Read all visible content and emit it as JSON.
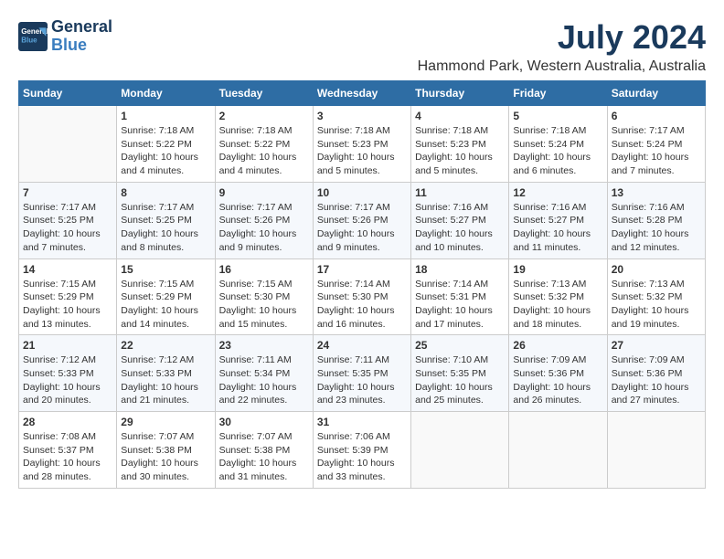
{
  "logo": {
    "line1": "General",
    "line2": "Blue"
  },
  "title": "July 2024",
  "subtitle": "Hammond Park, Western Australia, Australia",
  "columns": [
    "Sunday",
    "Monday",
    "Tuesday",
    "Wednesday",
    "Thursday",
    "Friday",
    "Saturday"
  ],
  "weeks": [
    [
      {
        "day": "",
        "info": ""
      },
      {
        "day": "1",
        "info": "Sunrise: 7:18 AM\nSunset: 5:22 PM\nDaylight: 10 hours\nand 4 minutes."
      },
      {
        "day": "2",
        "info": "Sunrise: 7:18 AM\nSunset: 5:22 PM\nDaylight: 10 hours\nand 4 minutes."
      },
      {
        "day": "3",
        "info": "Sunrise: 7:18 AM\nSunset: 5:23 PM\nDaylight: 10 hours\nand 5 minutes."
      },
      {
        "day": "4",
        "info": "Sunrise: 7:18 AM\nSunset: 5:23 PM\nDaylight: 10 hours\nand 5 minutes."
      },
      {
        "day": "5",
        "info": "Sunrise: 7:18 AM\nSunset: 5:24 PM\nDaylight: 10 hours\nand 6 minutes."
      },
      {
        "day": "6",
        "info": "Sunrise: 7:17 AM\nSunset: 5:24 PM\nDaylight: 10 hours\nand 7 minutes."
      }
    ],
    [
      {
        "day": "7",
        "info": "Sunrise: 7:17 AM\nSunset: 5:25 PM\nDaylight: 10 hours\nand 7 minutes."
      },
      {
        "day": "8",
        "info": "Sunrise: 7:17 AM\nSunset: 5:25 PM\nDaylight: 10 hours\nand 8 minutes."
      },
      {
        "day": "9",
        "info": "Sunrise: 7:17 AM\nSunset: 5:26 PM\nDaylight: 10 hours\nand 9 minutes."
      },
      {
        "day": "10",
        "info": "Sunrise: 7:17 AM\nSunset: 5:26 PM\nDaylight: 10 hours\nand 9 minutes."
      },
      {
        "day": "11",
        "info": "Sunrise: 7:16 AM\nSunset: 5:27 PM\nDaylight: 10 hours\nand 10 minutes."
      },
      {
        "day": "12",
        "info": "Sunrise: 7:16 AM\nSunset: 5:27 PM\nDaylight: 10 hours\nand 11 minutes."
      },
      {
        "day": "13",
        "info": "Sunrise: 7:16 AM\nSunset: 5:28 PM\nDaylight: 10 hours\nand 12 minutes."
      }
    ],
    [
      {
        "day": "14",
        "info": "Sunrise: 7:15 AM\nSunset: 5:29 PM\nDaylight: 10 hours\nand 13 minutes."
      },
      {
        "day": "15",
        "info": "Sunrise: 7:15 AM\nSunset: 5:29 PM\nDaylight: 10 hours\nand 14 minutes."
      },
      {
        "day": "16",
        "info": "Sunrise: 7:15 AM\nSunset: 5:30 PM\nDaylight: 10 hours\nand 15 minutes."
      },
      {
        "day": "17",
        "info": "Sunrise: 7:14 AM\nSunset: 5:30 PM\nDaylight: 10 hours\nand 16 minutes."
      },
      {
        "day": "18",
        "info": "Sunrise: 7:14 AM\nSunset: 5:31 PM\nDaylight: 10 hours\nand 17 minutes."
      },
      {
        "day": "19",
        "info": "Sunrise: 7:13 AM\nSunset: 5:32 PM\nDaylight: 10 hours\nand 18 minutes."
      },
      {
        "day": "20",
        "info": "Sunrise: 7:13 AM\nSunset: 5:32 PM\nDaylight: 10 hours\nand 19 minutes."
      }
    ],
    [
      {
        "day": "21",
        "info": "Sunrise: 7:12 AM\nSunset: 5:33 PM\nDaylight: 10 hours\nand 20 minutes."
      },
      {
        "day": "22",
        "info": "Sunrise: 7:12 AM\nSunset: 5:33 PM\nDaylight: 10 hours\nand 21 minutes."
      },
      {
        "day": "23",
        "info": "Sunrise: 7:11 AM\nSunset: 5:34 PM\nDaylight: 10 hours\nand 22 minutes."
      },
      {
        "day": "24",
        "info": "Sunrise: 7:11 AM\nSunset: 5:35 PM\nDaylight: 10 hours\nand 23 minutes."
      },
      {
        "day": "25",
        "info": "Sunrise: 7:10 AM\nSunset: 5:35 PM\nDaylight: 10 hours\nand 25 minutes."
      },
      {
        "day": "26",
        "info": "Sunrise: 7:09 AM\nSunset: 5:36 PM\nDaylight: 10 hours\nand 26 minutes."
      },
      {
        "day": "27",
        "info": "Sunrise: 7:09 AM\nSunset: 5:36 PM\nDaylight: 10 hours\nand 27 minutes."
      }
    ],
    [
      {
        "day": "28",
        "info": "Sunrise: 7:08 AM\nSunset: 5:37 PM\nDaylight: 10 hours\nand 28 minutes."
      },
      {
        "day": "29",
        "info": "Sunrise: 7:07 AM\nSunset: 5:38 PM\nDaylight: 10 hours\nand 30 minutes."
      },
      {
        "day": "30",
        "info": "Sunrise: 7:07 AM\nSunset: 5:38 PM\nDaylight: 10 hours\nand 31 minutes."
      },
      {
        "day": "31",
        "info": "Sunrise: 7:06 AM\nSunset: 5:39 PM\nDaylight: 10 hours\nand 33 minutes."
      },
      {
        "day": "",
        "info": ""
      },
      {
        "day": "",
        "info": ""
      },
      {
        "day": "",
        "info": ""
      }
    ]
  ]
}
